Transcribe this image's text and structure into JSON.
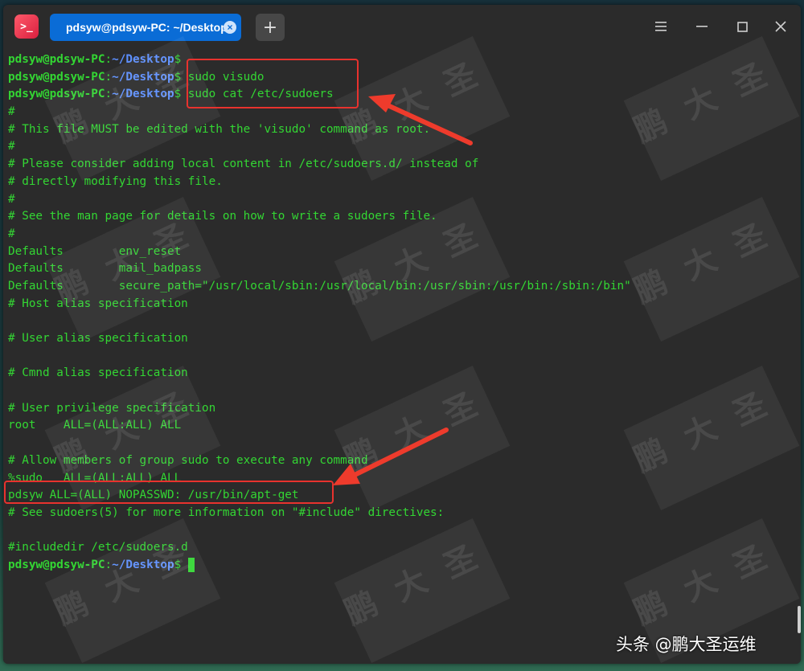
{
  "window": {
    "tab_title": "pdsyw@pdsyw-PC: ~/Desktop",
    "tab_close": "×",
    "add_tab": "+"
  },
  "prompt": {
    "user_host": "pdsyw@pdsyw-PC",
    "sep": ":",
    "path": "~/Desktop",
    "dollar": "$"
  },
  "terminal": {
    "lines": [
      {
        "kind": "prompt",
        "cmd": ""
      },
      {
        "kind": "prompt",
        "cmd": " sudo visudo"
      },
      {
        "kind": "prompt",
        "cmd": " sudo cat /etc/sudoers"
      },
      {
        "kind": "text",
        "text": "#"
      },
      {
        "kind": "text",
        "text": "# This file MUST be edited with the 'visudo' command as root."
      },
      {
        "kind": "text",
        "text": "#"
      },
      {
        "kind": "text",
        "text": "# Please consider adding local content in /etc/sudoers.d/ instead of"
      },
      {
        "kind": "text",
        "text": "# directly modifying this file."
      },
      {
        "kind": "text",
        "text": "#"
      },
      {
        "kind": "text",
        "text": "# See the man page for details on how to write a sudoers file."
      },
      {
        "kind": "text",
        "text": "#"
      },
      {
        "kind": "text",
        "text": "Defaults        env_reset"
      },
      {
        "kind": "text",
        "text": "Defaults        mail_badpass"
      },
      {
        "kind": "text",
        "text": "Defaults        secure_path=\"/usr/local/sbin:/usr/local/bin:/usr/sbin:/usr/bin:/sbin:/bin\""
      },
      {
        "kind": "text",
        "text": "# Host alias specification"
      },
      {
        "kind": "text",
        "text": ""
      },
      {
        "kind": "text",
        "text": "# User alias specification"
      },
      {
        "kind": "text",
        "text": ""
      },
      {
        "kind": "text",
        "text": "# Cmnd alias specification"
      },
      {
        "kind": "text",
        "text": ""
      },
      {
        "kind": "text",
        "text": "# User privilege specification"
      },
      {
        "kind": "text",
        "text": "root    ALL=(ALL:ALL) ALL"
      },
      {
        "kind": "text",
        "text": ""
      },
      {
        "kind": "text",
        "text": "# Allow members of group sudo to execute any command"
      },
      {
        "kind": "text",
        "text": "%sudo   ALL=(ALL:ALL) ALL"
      },
      {
        "kind": "text",
        "text": "pdsyw ALL=(ALL) NOPASSWD: /usr/bin/apt-get"
      },
      {
        "kind": "text",
        "text": "# See sudoers(5) for more information on \"#include\" directives:"
      },
      {
        "kind": "text",
        "text": ""
      },
      {
        "kind": "text",
        "text": "#includedir /etc/sudoers.d"
      },
      {
        "kind": "prompt_cursor",
        "cmd": ""
      }
    ]
  },
  "watermark": "鹏大圣",
  "credit": "头条 @鹏大圣运维",
  "colors": {
    "prompt_user": "#33d633",
    "prompt_path": "#5c8fff",
    "highlight": "#e8322e",
    "tab_active": "#0a6cd6"
  }
}
